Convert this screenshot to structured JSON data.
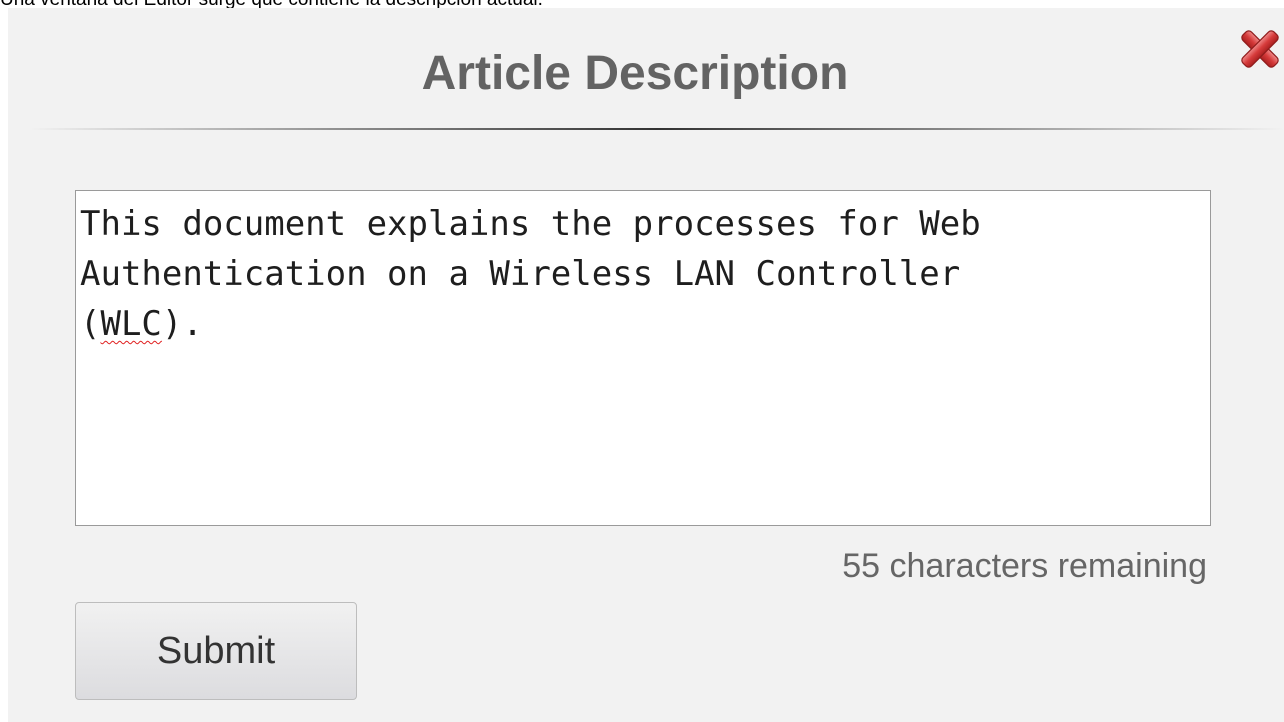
{
  "caption": "Una ventana del Editor surge que contiene la descripción actual.",
  "dialog": {
    "title": "Article Description",
    "close_icon": "close-x-icon",
    "description": {
      "before": "This document explains the processes for Web\nAuthentication on a Wireless LAN Controller\n(",
      "misspelled": "WLC",
      "after": ")."
    },
    "remaining_text": "55 characters remaining",
    "submit_label": "Submit"
  },
  "colors": {
    "dialog_bg": "#f2f2f2",
    "title": "#636363",
    "close_icon": "#d23a3a",
    "spellcheck_underline": "#e02020"
  }
}
